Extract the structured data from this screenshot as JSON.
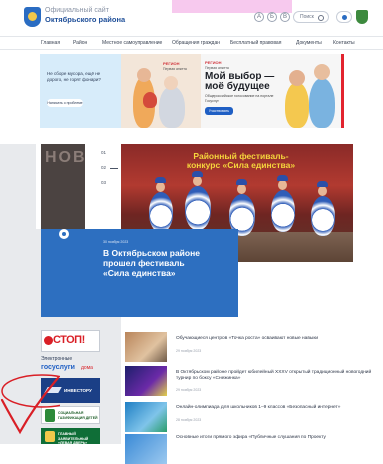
{
  "header": {
    "subtitle": "Официальный сайт",
    "title": "Октябрьского района",
    "search_label": "Поиск",
    "font_buttons": [
      "А",
      "Б",
      "В"
    ]
  },
  "nav": {
    "items": [
      "Главная",
      "Район",
      "Местное самоуправление",
      "Обращения граждан",
      "Бесплатный правовая",
      "Документы",
      "Контакты"
    ]
  },
  "banners": {
    "b1": {
      "text": "Не сборе мусора, ещё не дорого, не горят фонари?",
      "button": "Написать о проблеме"
    },
    "b2": {
      "brand": "РЕГИОН",
      "sub": "Первая анкета"
    },
    "b3": {
      "brand": "РЕГИОН",
      "sub": "Первая анкета",
      "big": "Мой выбор — моё будущее",
      "small": "Общероссийское голосование на портале Госуслуг",
      "button": "Участвовать"
    }
  },
  "feature": {
    "side_letters": "НОВСТ",
    "pagination": [
      "01",
      "02",
      "03"
    ],
    "photo_title": "Районный фестиваль-конкурс «Сила единства»",
    "date": "30 ноября 2023",
    "title": "В Октябрьском районе прошел фестиваль «Сила единства»"
  },
  "side_banners": {
    "stop": "СТОП!",
    "gos_line1": "Электронные",
    "gos_line2": "госуслуги",
    "gos_line3": "дома",
    "investor": "ИНВЕСТОРУ",
    "social1": "СОЦИАЛЬНАЯ ГАЗИФИКАЦИЯ ДЕТЕЙ",
    "social2": "ГЛАВНЫЙ ЗАЯВИТЕЛЬНЫЙ «ЛЕВАЯ ДВЕРЬ» ДЕТЕЙ"
  },
  "news": [
    {
      "title": "Обучающиеся центров «Точка роста» осваивают новые навыки",
      "date": "29 ноября 2023"
    },
    {
      "title": "В Октябрьском районе пройдет юбилейный XXXV открытый традиционный новогодний турнир по боксу «Снежинка»",
      "date": "29 ноября 2023"
    },
    {
      "title": "Онлайн-олимпиада для школьников 1–9 классов «Безопасный интернет»",
      "date": "28 ноября 2023"
    },
    {
      "title": "Основные итоги прямого эфира «Публичные слушания по Проекту",
      "date": ""
    }
  ],
  "colors": {
    "brand": "#2d6fc0",
    "accent_red": "#d91f26"
  }
}
